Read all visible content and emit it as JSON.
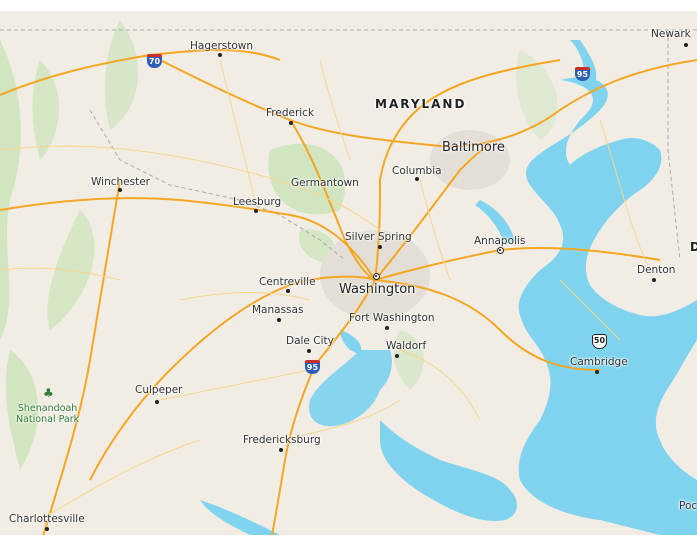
{
  "map": {
    "colors": {
      "land": "#f1ede4",
      "water": "#7fd3ee",
      "forest": "#cde3bc",
      "highway": "#f5a623",
      "road": "#f9d58a",
      "border": "#a9a9a9"
    },
    "states": [
      {
        "name": "MARYLAND"
      },
      {
        "name": "D"
      }
    ],
    "cities": [
      {
        "name": "Hagerstown"
      },
      {
        "name": "Frederick"
      },
      {
        "name": "Newark"
      },
      {
        "name": "Baltimore"
      },
      {
        "name": "Columbia"
      },
      {
        "name": "Germantown"
      },
      {
        "name": "Winchester"
      },
      {
        "name": "Leesburg"
      },
      {
        "name": "Silver Spring"
      },
      {
        "name": "Annapolis"
      },
      {
        "name": "Denton"
      },
      {
        "name": "Centreville"
      },
      {
        "name": "Washington"
      },
      {
        "name": "Manassas"
      },
      {
        "name": "Fort Washington"
      },
      {
        "name": "Dale City"
      },
      {
        "name": "Waldorf"
      },
      {
        "name": "Cambridge"
      },
      {
        "name": "Culpeper"
      },
      {
        "name": "Fredericksburg"
      },
      {
        "name": "Charlottesville"
      },
      {
        "name": "Poc"
      }
    ],
    "parks": [
      {
        "name": "Shenandoah\nNational Park",
        "icon": "tree-icon"
      }
    ],
    "shields": [
      {
        "type": "interstate",
        "number": "70"
      },
      {
        "type": "interstate",
        "number": "95"
      },
      {
        "type": "interstate",
        "number": "95"
      },
      {
        "type": "us-route",
        "number": "50"
      }
    ]
  }
}
